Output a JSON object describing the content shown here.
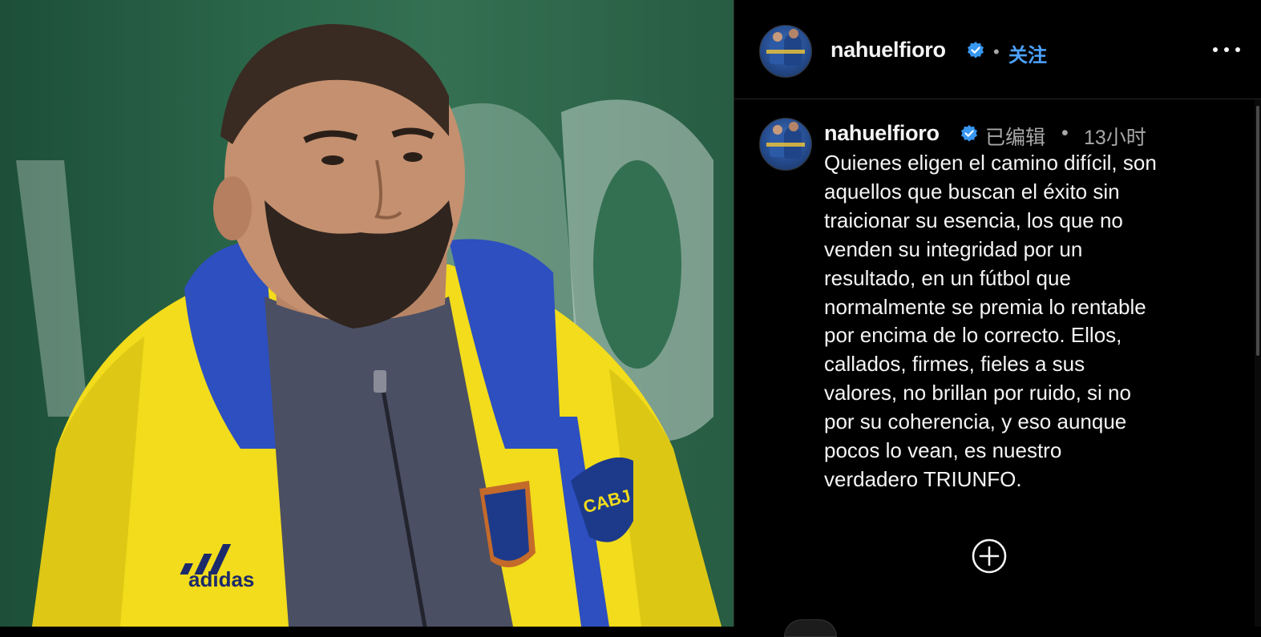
{
  "post": {
    "image_alt": "",
    "username": "nahuelfioro",
    "follow_label": "关注",
    "separator": "•",
    "edited_label": "已编辑",
    "time_ago": "13小时",
    "caption": "Quienes eligen el camino difícil, son\naquellos que buscan el éxito sin\ntraicionar su esencia, los que no\nvenden su integridad por un\nresultado, en un fútbol que\nnormalmente se premia lo rentable\npor encima de lo correcto.  Ellos,\ncallados, firmes, fieles a sus\nvalores, no brillan por ruido, si no\npor su coherencia, y eso aunque\npocos lo vean, es nuestro\nverdadero TRIUNFO."
  },
  "photo": {
    "jacket_brand": "adidas",
    "crest_text": "CABJ"
  },
  "icons": {
    "verified": "verified-badge-icon",
    "more": "more-options-icon",
    "add": "add-circle-icon"
  },
  "colors": {
    "background": "#000000",
    "text": "#f5f5f5",
    "muted": "#a8a8a8",
    "link": "#4da3ff",
    "verified": "#3897f0"
  }
}
